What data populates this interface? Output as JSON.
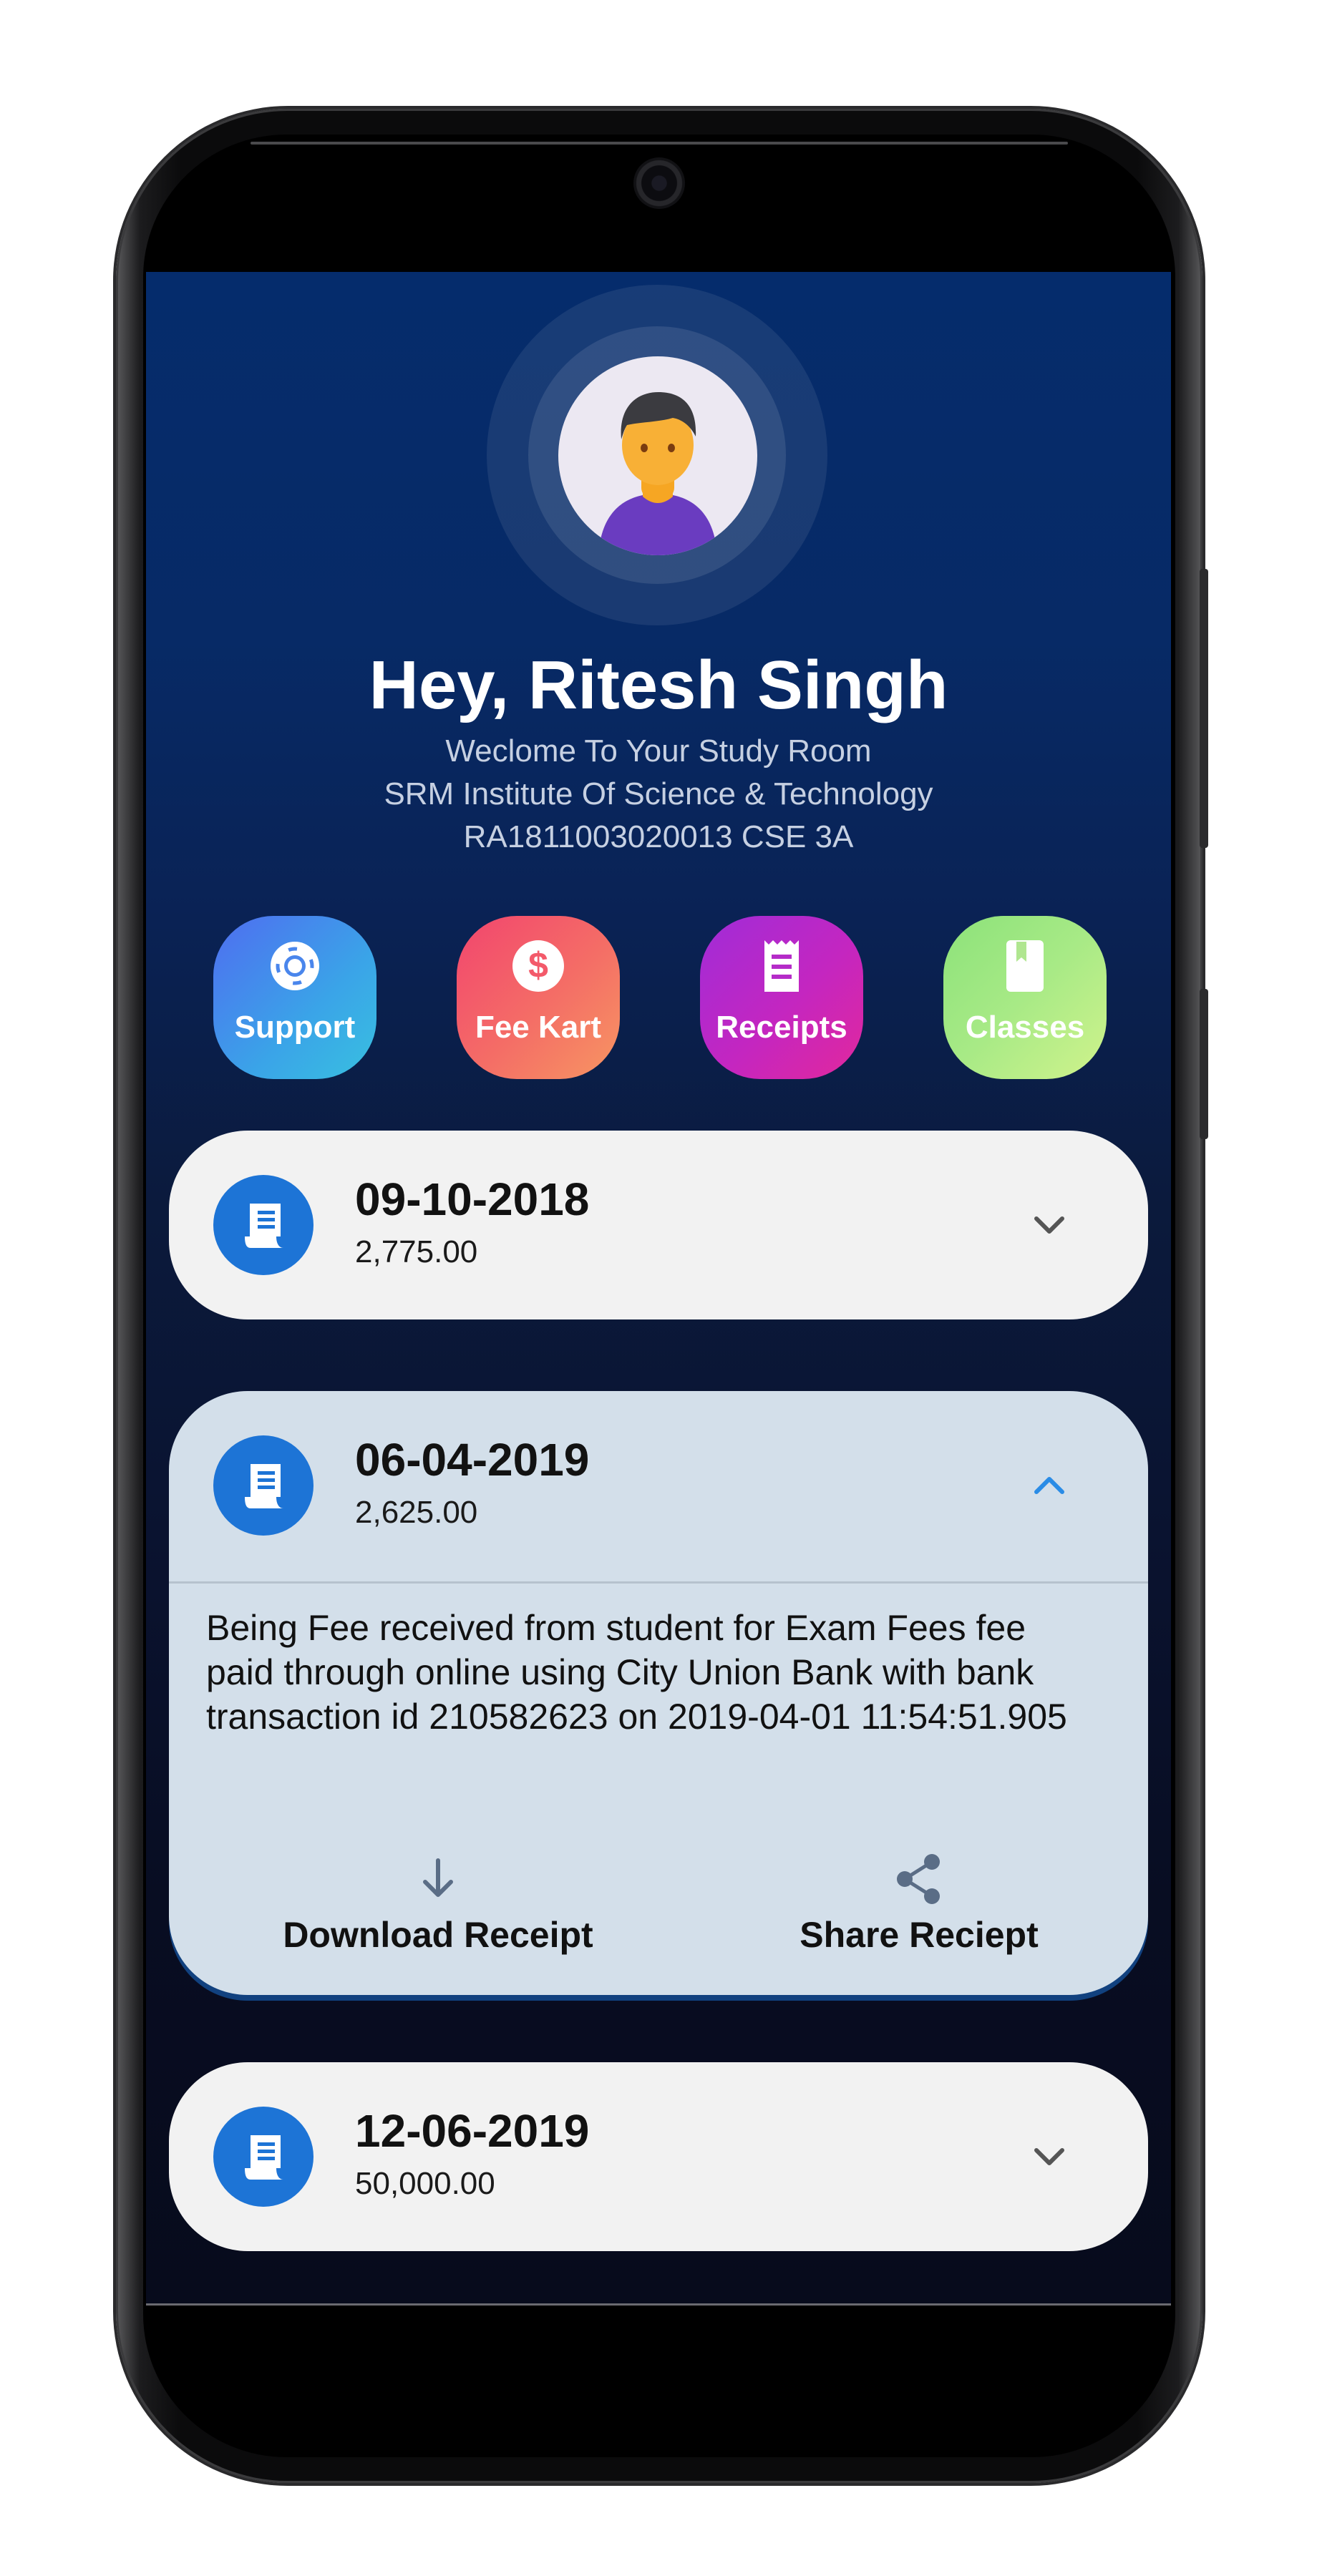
{
  "user": {
    "greeting": "Hey, Ritesh Singh",
    "welcome": "Weclome To Your Study Room",
    "institute": "SRM Institute Of Science & Technology",
    "reg_info": "RA1811003020013 CSE 3A"
  },
  "actions": [
    {
      "label": "Support",
      "icon": "lifebuoy-icon"
    },
    {
      "label": "Fee Kart",
      "icon": "dollar-icon"
    },
    {
      "label": "Receipts",
      "icon": "receipt-icon"
    },
    {
      "label": "Classes",
      "icon": "book-icon"
    }
  ],
  "receipts": [
    {
      "date": "09-10-2018",
      "amount": "2,775.00",
      "expanded": false
    },
    {
      "date": "06-04-2019",
      "amount": "2,625.00",
      "expanded": true,
      "description": "Being Fee received from student for Exam Fees fee paid through online using City Union Bank with bank transaction id 210582623 on 2019-04-01 11:54:51.905",
      "download_label": "Download Receipt",
      "share_label": "Share Reciept"
    },
    {
      "date": "12-06-2019",
      "amount": "50,000.00",
      "expanded": false
    }
  ],
  "colors": {
    "accent_blue": "#1d74d6",
    "background_top": "#052c6c",
    "background_bottom": "#070b1c",
    "card": "#f2f2f2",
    "card_expanded": "#d3dfea"
  }
}
